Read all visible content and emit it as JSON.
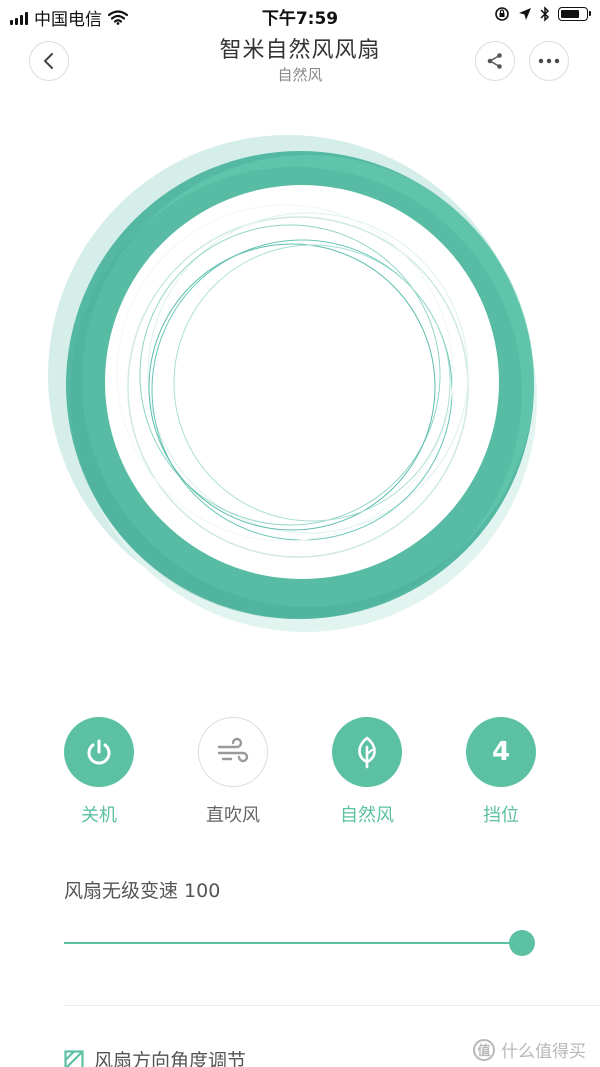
{
  "status_bar": {
    "carrier": "中国电信",
    "time": "下午7:59",
    "battery_level": 0.8
  },
  "header": {
    "title": "智米自然风风扇",
    "subtitle": "自然风",
    "icons": {
      "back": "chevron-left-icon",
      "share": "share-icon",
      "more": "more-icon"
    }
  },
  "modes": [
    {
      "label": "关机",
      "icon": "power-icon",
      "active": true
    },
    {
      "label": "直吹风",
      "icon": "wind-icon",
      "active": false
    },
    {
      "label": "自然风",
      "icon": "leaf-icon",
      "active": true
    },
    {
      "label": "挡位",
      "icon": "gear-number",
      "value": "4",
      "active": true
    }
  ],
  "speed": {
    "label": "风扇无级变速 100",
    "value": 100,
    "max": 100
  },
  "angle": {
    "label": "风扇方向角度调节",
    "icon": "checkbox-icon"
  },
  "watermark": {
    "badge": "值",
    "text": "什么值得买"
  },
  "colors": {
    "accent": "#5cc0a3",
    "ring_dark": "#4fb39c",
    "ring_light": "#cdebe4",
    "thin_lines": "#67c6b6"
  }
}
